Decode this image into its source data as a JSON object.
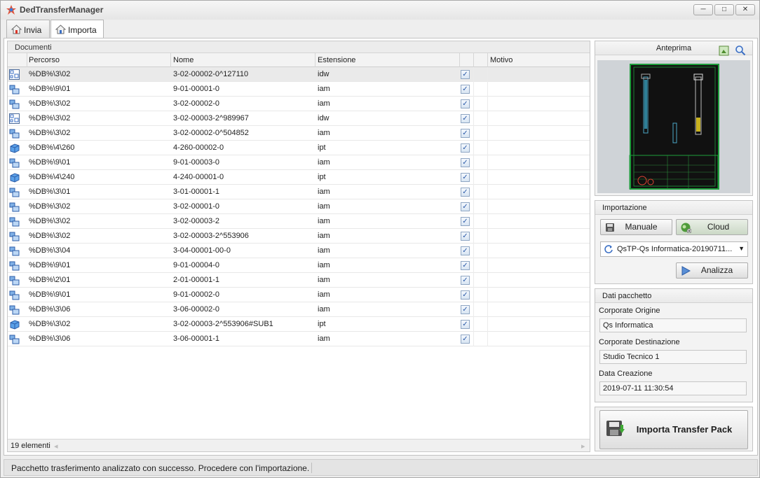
{
  "window": {
    "title": "DedTransferManager"
  },
  "tabs": [
    {
      "label": "Invia"
    },
    {
      "label": "Importa"
    }
  ],
  "grid": {
    "group_header": "Documenti",
    "columns": [
      "Percorso",
      "Nome",
      "Estensione",
      "Motivo"
    ],
    "rows": [
      {
        "path": "%DB%\\3\\02",
        "name": "3-02-00002-0^127110",
        "ext": "idw"
      },
      {
        "path": "%DB%\\9\\01",
        "name": "9-01-00001-0",
        "ext": "iam"
      },
      {
        "path": "%DB%\\3\\02",
        "name": "3-02-00002-0",
        "ext": "iam"
      },
      {
        "path": "%DB%\\3\\02",
        "name": "3-02-00003-2^989967",
        "ext": "idw"
      },
      {
        "path": "%DB%\\3\\02",
        "name": "3-02-00002-0^504852",
        "ext": "iam"
      },
      {
        "path": "%DB%\\4\\260",
        "name": "4-260-00002-0",
        "ext": "ipt"
      },
      {
        "path": "%DB%\\9\\01",
        "name": "9-01-00003-0",
        "ext": "iam"
      },
      {
        "path": "%DB%\\4\\240",
        "name": "4-240-00001-0",
        "ext": "ipt"
      },
      {
        "path": "%DB%\\3\\01",
        "name": "3-01-00001-1",
        "ext": "iam"
      },
      {
        "path": "%DB%\\3\\02",
        "name": "3-02-00001-0",
        "ext": "iam"
      },
      {
        "path": "%DB%\\3\\02",
        "name": "3-02-00003-2",
        "ext": "iam"
      },
      {
        "path": "%DB%\\3\\02",
        "name": "3-02-00003-2^553906",
        "ext": "iam"
      },
      {
        "path": "%DB%\\3\\04",
        "name": "3-04-00001-00-0",
        "ext": "iam"
      },
      {
        "path": "%DB%\\9\\01",
        "name": "9-01-00004-0",
        "ext": "iam"
      },
      {
        "path": "%DB%\\2\\01",
        "name": "2-01-00001-1",
        "ext": "iam"
      },
      {
        "path": "%DB%\\9\\01",
        "name": "9-01-00002-0",
        "ext": "iam"
      },
      {
        "path": "%DB%\\3\\06",
        "name": "3-06-00002-0",
        "ext": "iam"
      },
      {
        "path": "%DB%\\3\\02",
        "name": "3-02-00003-2^553906#SUB1",
        "ext": "ipt"
      },
      {
        "path": "%DB%\\3\\06",
        "name": "3-06-00001-1",
        "ext": "iam"
      }
    ],
    "footer": "19 elementi"
  },
  "preview": {
    "title": "Anteprima"
  },
  "import": {
    "title": "Importazione",
    "manual_label": "Manuale",
    "cloud_label": "Cloud",
    "package_selected": "QsTP-Qs Informatica-20190711...",
    "analyze_label": "Analizza"
  },
  "package": {
    "title": "Dati pacchetto",
    "origin_label": "Corporate Origine",
    "origin_value": "Qs Informatica",
    "dest_label": "Corporate Destinazione",
    "dest_value": "Studio Tecnico 1",
    "date_label": "Data Creazione",
    "date_value": "2019-07-11 11:30:54"
  },
  "import_button": "Importa Transfer Pack",
  "status": "Pacchetto trasferimento analizzato con successo. Procedere con l'importazione."
}
